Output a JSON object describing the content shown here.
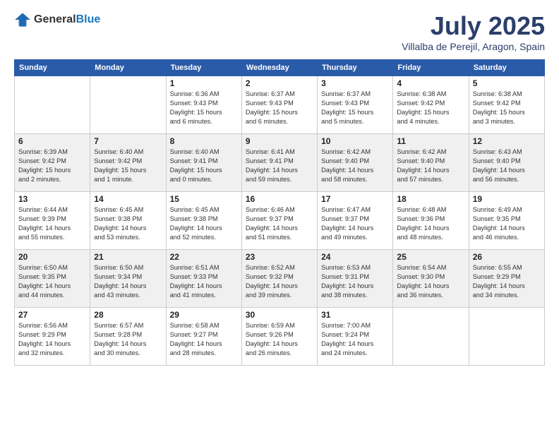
{
  "logo": {
    "general": "General",
    "blue": "Blue"
  },
  "header": {
    "month": "July 2025",
    "location": "Villalba de Perejil, Aragon, Spain"
  },
  "weekdays": [
    "Sunday",
    "Monday",
    "Tuesday",
    "Wednesday",
    "Thursday",
    "Friday",
    "Saturday"
  ],
  "weeks": [
    [
      {
        "day": "",
        "info": ""
      },
      {
        "day": "",
        "info": ""
      },
      {
        "day": "1",
        "info": "Sunrise: 6:36 AM\nSunset: 9:43 PM\nDaylight: 15 hours\nand 6 minutes."
      },
      {
        "day": "2",
        "info": "Sunrise: 6:37 AM\nSunset: 9:43 PM\nDaylight: 15 hours\nand 6 minutes."
      },
      {
        "day": "3",
        "info": "Sunrise: 6:37 AM\nSunset: 9:43 PM\nDaylight: 15 hours\nand 5 minutes."
      },
      {
        "day": "4",
        "info": "Sunrise: 6:38 AM\nSunset: 9:42 PM\nDaylight: 15 hours\nand 4 minutes."
      },
      {
        "day": "5",
        "info": "Sunrise: 6:38 AM\nSunset: 9:42 PM\nDaylight: 15 hours\nand 3 minutes."
      }
    ],
    [
      {
        "day": "6",
        "info": "Sunrise: 6:39 AM\nSunset: 9:42 PM\nDaylight: 15 hours\nand 2 minutes."
      },
      {
        "day": "7",
        "info": "Sunrise: 6:40 AM\nSunset: 9:42 PM\nDaylight: 15 hours\nand 1 minute."
      },
      {
        "day": "8",
        "info": "Sunrise: 6:40 AM\nSunset: 9:41 PM\nDaylight: 15 hours\nand 0 minutes."
      },
      {
        "day": "9",
        "info": "Sunrise: 6:41 AM\nSunset: 9:41 PM\nDaylight: 14 hours\nand 59 minutes."
      },
      {
        "day": "10",
        "info": "Sunrise: 6:42 AM\nSunset: 9:40 PM\nDaylight: 14 hours\nand 58 minutes."
      },
      {
        "day": "11",
        "info": "Sunrise: 6:42 AM\nSunset: 9:40 PM\nDaylight: 14 hours\nand 57 minutes."
      },
      {
        "day": "12",
        "info": "Sunrise: 6:43 AM\nSunset: 9:40 PM\nDaylight: 14 hours\nand 56 minutes."
      }
    ],
    [
      {
        "day": "13",
        "info": "Sunrise: 6:44 AM\nSunset: 9:39 PM\nDaylight: 14 hours\nand 55 minutes."
      },
      {
        "day": "14",
        "info": "Sunrise: 6:45 AM\nSunset: 9:38 PM\nDaylight: 14 hours\nand 53 minutes."
      },
      {
        "day": "15",
        "info": "Sunrise: 6:45 AM\nSunset: 9:38 PM\nDaylight: 14 hours\nand 52 minutes."
      },
      {
        "day": "16",
        "info": "Sunrise: 6:46 AM\nSunset: 9:37 PM\nDaylight: 14 hours\nand 51 minutes."
      },
      {
        "day": "17",
        "info": "Sunrise: 6:47 AM\nSunset: 9:37 PM\nDaylight: 14 hours\nand 49 minutes."
      },
      {
        "day": "18",
        "info": "Sunrise: 6:48 AM\nSunset: 9:36 PM\nDaylight: 14 hours\nand 48 minutes."
      },
      {
        "day": "19",
        "info": "Sunrise: 6:49 AM\nSunset: 9:35 PM\nDaylight: 14 hours\nand 46 minutes."
      }
    ],
    [
      {
        "day": "20",
        "info": "Sunrise: 6:50 AM\nSunset: 9:35 PM\nDaylight: 14 hours\nand 44 minutes."
      },
      {
        "day": "21",
        "info": "Sunrise: 6:50 AM\nSunset: 9:34 PM\nDaylight: 14 hours\nand 43 minutes."
      },
      {
        "day": "22",
        "info": "Sunrise: 6:51 AM\nSunset: 9:33 PM\nDaylight: 14 hours\nand 41 minutes."
      },
      {
        "day": "23",
        "info": "Sunrise: 6:52 AM\nSunset: 9:32 PM\nDaylight: 14 hours\nand 39 minutes."
      },
      {
        "day": "24",
        "info": "Sunrise: 6:53 AM\nSunset: 9:31 PM\nDaylight: 14 hours\nand 38 minutes."
      },
      {
        "day": "25",
        "info": "Sunrise: 6:54 AM\nSunset: 9:30 PM\nDaylight: 14 hours\nand 36 minutes."
      },
      {
        "day": "26",
        "info": "Sunrise: 6:55 AM\nSunset: 9:29 PM\nDaylight: 14 hours\nand 34 minutes."
      }
    ],
    [
      {
        "day": "27",
        "info": "Sunrise: 6:56 AM\nSunset: 9:29 PM\nDaylight: 14 hours\nand 32 minutes."
      },
      {
        "day": "28",
        "info": "Sunrise: 6:57 AM\nSunset: 9:28 PM\nDaylight: 14 hours\nand 30 minutes."
      },
      {
        "day": "29",
        "info": "Sunrise: 6:58 AM\nSunset: 9:27 PM\nDaylight: 14 hours\nand 28 minutes."
      },
      {
        "day": "30",
        "info": "Sunrise: 6:59 AM\nSunset: 9:26 PM\nDaylight: 14 hours\nand 26 minutes."
      },
      {
        "day": "31",
        "info": "Sunrise: 7:00 AM\nSunset: 9:24 PM\nDaylight: 14 hours\nand 24 minutes."
      },
      {
        "day": "",
        "info": ""
      },
      {
        "day": "",
        "info": ""
      }
    ]
  ]
}
